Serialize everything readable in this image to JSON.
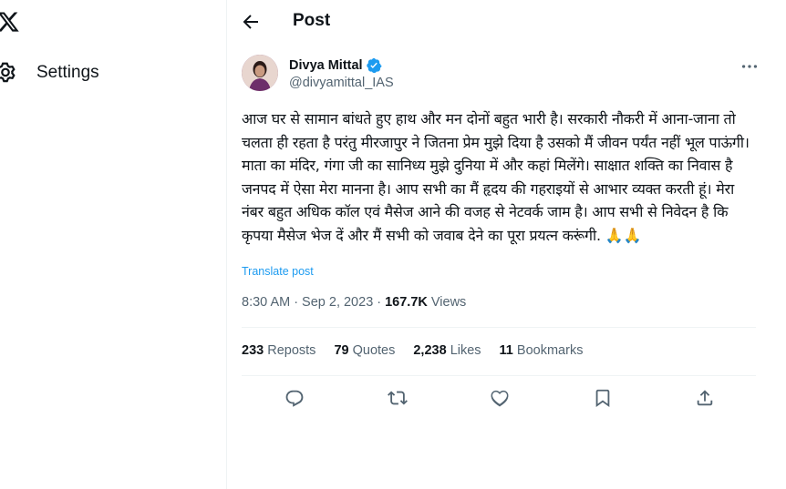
{
  "nav": {
    "logo_icon": "x-logo-icon",
    "settings_label": "Settings"
  },
  "header": {
    "title": "Post"
  },
  "post": {
    "author_name": "Divya Mittal",
    "author_handle": "@divyamittal_IAS",
    "verified": true,
    "text": "आज घर से सामान बांधते हुए हाथ और मन दोनों बहुत भारी है। सरकारी नौकरी में आना-जाना तो चलता ही रहता है परंतु मीरजापुर ने जितना प्रेम मुझे दिया है उसको मैं जीवन पर्यंत नहीं भूल पाऊंगी। माता का मंदिर, गंगा जी का सानिध्य मुझे दुनिया में और कहां मिलेंगे। साक्षात शक्ति का निवास है जनपद में ऐसा मेरा मानना है। आप सभी का मैं हृदय की गहराइयों से आभार व्यक्त करती हूं। मेरा नंबर बहुत अधिक कॉल एवं मैसेज आने की वजह से नेटवर्क जाम है। आप सभी से निवेदन है कि कृपया मैसेज भेज दें और मैं सभी को जवाब देने का पूरा प्रयत्न करूंगी. 🙏🙏",
    "translate_label": "Translate post",
    "time": "8:30 AM",
    "date": "Sep 2, 2023",
    "views_count": "167.7K",
    "views_label": "Views"
  },
  "stats": {
    "reposts_count": "233",
    "reposts_label": "Reposts",
    "quotes_count": "79",
    "quotes_label": "Quotes",
    "likes_count": "2,238",
    "likes_label": "Likes",
    "bookmarks_count": "11",
    "bookmarks_label": "Bookmarks"
  },
  "colors": {
    "accent": "#1d9bf0",
    "secondary_text": "#536471",
    "primary_text": "#0f1419",
    "divider": "#eff3f4"
  }
}
